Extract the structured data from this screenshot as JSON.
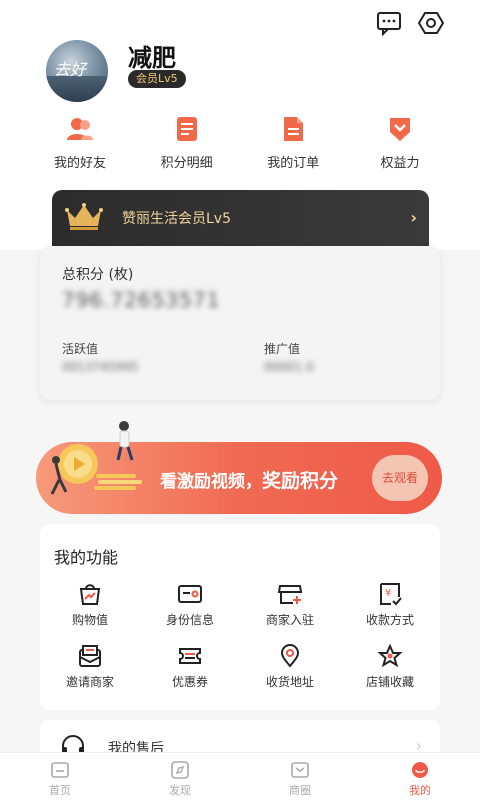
{
  "profile": {
    "name": "减肥",
    "member_badge": "会员Lv5",
    "avatar_text": "去好"
  },
  "quick_actions": [
    {
      "label": "我的好友",
      "icon": "friends-icon"
    },
    {
      "label": "积分明细",
      "icon": "points-detail-icon"
    },
    {
      "label": "我的订单",
      "icon": "orders-icon"
    },
    {
      "label": "权益力",
      "icon": "benefits-icon"
    }
  ],
  "vip": {
    "text": "赞丽生活会员",
    "level": "Lv5",
    "icon": "crown-icon"
  },
  "points": {
    "title": "总积分 (枚)",
    "value": "796.72653571",
    "active_label": "活跃值",
    "active_value": "0013745995",
    "promo_label": "推广值",
    "promo_value": "00001.0"
  },
  "reward": {
    "text_a": "看激励视频，",
    "text_b": "奖励积分",
    "button": "去观看"
  },
  "functions": {
    "title": "我的功能",
    "items": [
      {
        "label": "购物值",
        "icon": "shopping-value-icon"
      },
      {
        "label": "身份信息",
        "icon": "id-card-icon"
      },
      {
        "label": "商家入驻",
        "icon": "merchant-join-icon"
      },
      {
        "label": "收款方式",
        "icon": "payment-method-icon"
      },
      {
        "label": "邀请商家",
        "icon": "invite-merchant-icon"
      },
      {
        "label": "优惠券",
        "icon": "coupon-icon"
      },
      {
        "label": "收货地址",
        "icon": "location-icon"
      },
      {
        "label": "店铺收藏",
        "icon": "store-favorite-icon"
      }
    ]
  },
  "after_sales": {
    "label": "我的售后"
  },
  "tabs": [
    {
      "label": "首页",
      "icon": "home-icon"
    },
    {
      "label": "发现",
      "icon": "discover-icon"
    },
    {
      "label": "商圈",
      "icon": "business-circle-icon"
    },
    {
      "label": "我的",
      "icon": "me-icon",
      "active": true
    }
  ],
  "colors": {
    "accent": "#ef5a48",
    "gold": "#f2d49a",
    "vip_bg": "#2c2c2c"
  }
}
